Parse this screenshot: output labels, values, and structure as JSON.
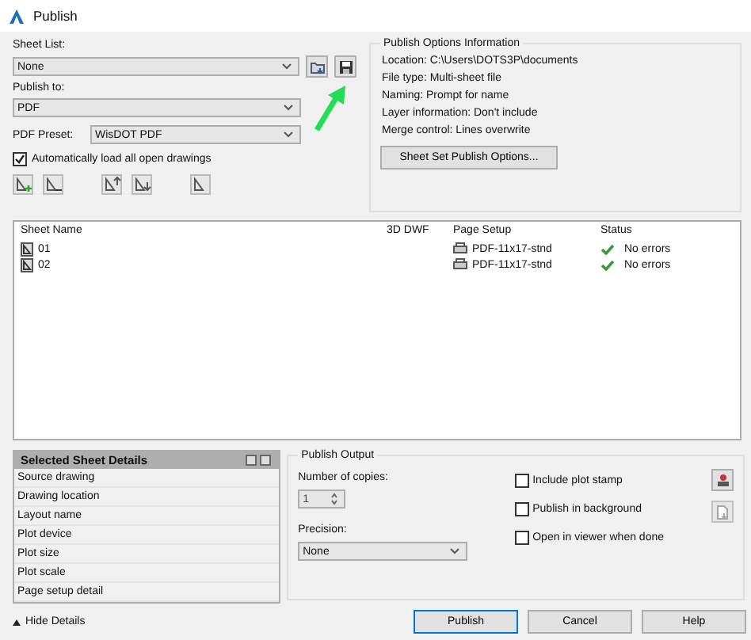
{
  "window": {
    "title": "Publish"
  },
  "sheet_list": {
    "label": "Sheet List:",
    "value": "None"
  },
  "publish_to": {
    "label": "Publish to:",
    "value": "PDF"
  },
  "pdf_preset": {
    "label": "PDF Preset:",
    "value": "WisDOT PDF"
  },
  "auto_load": {
    "label": "Automatically load all open drawings",
    "checked": true
  },
  "publish_options": {
    "title": "Publish Options Information",
    "lines": [
      "Location:  C:\\Users\\DOTS3P\\documents",
      "File type: Multi-sheet file",
      "Naming: Prompt for name",
      "Layer information: Don't include",
      "Merge control: Lines overwrite"
    ],
    "button": "Sheet Set Publish Options..."
  },
  "table": {
    "columns": [
      "Sheet Name",
      "3D DWF",
      "Page Setup",
      "Status"
    ],
    "rows": [
      {
        "sheet": "01",
        "page_setup": "PDF-11x17-stnd",
        "status": "No errors"
      },
      {
        "sheet": "02",
        "page_setup": "PDF-11x17-stnd",
        "status": "No errors"
      }
    ]
  },
  "details": {
    "title": "Selected Sheet Details",
    "items": [
      "Source drawing",
      "Drawing location",
      "Layout name",
      "Plot device",
      "Plot size",
      "Plot scale",
      "Page setup detail"
    ]
  },
  "publish_output": {
    "title": "Publish Output",
    "copies_label": "Number of copies:",
    "copies": "1",
    "precision_label": "Precision:",
    "precision": "None",
    "options": [
      {
        "label": "Include plot stamp",
        "checked": false
      },
      {
        "label": "Publish in background",
        "checked": false
      },
      {
        "label": "Open in viewer when done",
        "checked": false
      }
    ]
  },
  "toggle_details": "Hide Details",
  "buttons": [
    {
      "label": "Publish",
      "selected": true
    },
    {
      "label": "Cancel",
      "selected": false
    },
    {
      "label": "Help",
      "selected": false
    }
  ]
}
